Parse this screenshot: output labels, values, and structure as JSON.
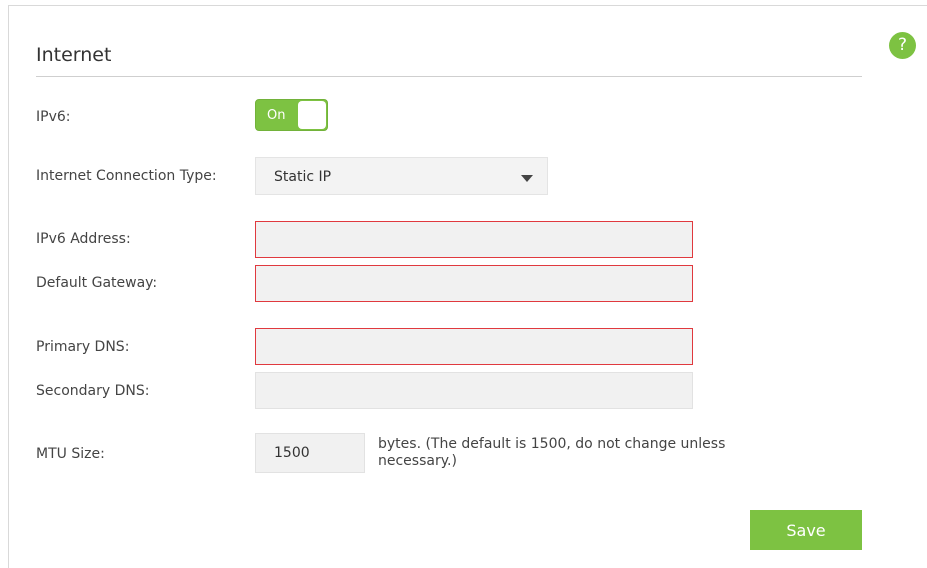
{
  "section": {
    "title": "Internet"
  },
  "help": {
    "icon": "help-icon",
    "symbol": "?"
  },
  "ipv6": {
    "label": "IPv6:",
    "toggle_text": "On",
    "enabled": true
  },
  "connection_type": {
    "label": "Internet Connection Type:",
    "selected": "Static IP"
  },
  "ipv6_address": {
    "label": "IPv6 Address:",
    "value": ""
  },
  "default_gateway": {
    "label": "Default Gateway:",
    "value": ""
  },
  "primary_dns": {
    "label": "Primary DNS:",
    "value": ""
  },
  "secondary_dns": {
    "label": "Secondary DNS:",
    "value": ""
  },
  "mtu": {
    "label": "MTU Size:",
    "value": "1500",
    "note": "bytes. (The default is 1500, do not change unless necessary.)"
  },
  "actions": {
    "save_label": "Save"
  },
  "colors": {
    "accent": "#7dc242",
    "error_border": "#e0393e"
  }
}
